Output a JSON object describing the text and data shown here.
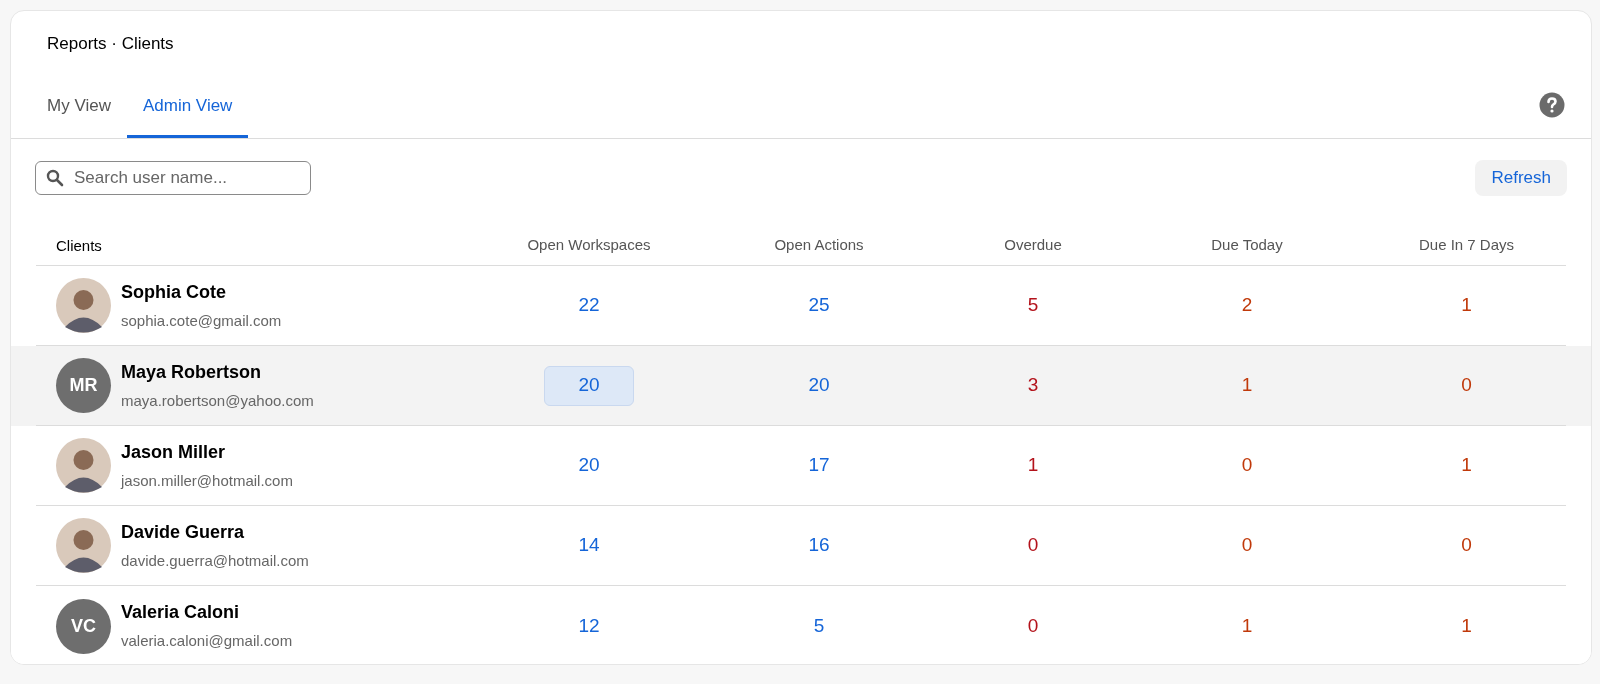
{
  "breadcrumb": "Reports · Clients",
  "tabs": [
    {
      "label": "My View",
      "selected": false
    },
    {
      "label": "Admin View",
      "selected": true
    }
  ],
  "search": {
    "placeholder": "Search user name..."
  },
  "refresh_button": "Refresh",
  "table": {
    "columns": [
      {
        "label": "Clients",
        "kind": "client"
      },
      {
        "label": "Open Workspaces",
        "kind": "count"
      },
      {
        "label": "Open Actions",
        "kind": "count"
      },
      {
        "label": "Overdue",
        "kind": "alert"
      },
      {
        "label": "Due Today",
        "kind": "warning"
      },
      {
        "label": "Due In 7 Days",
        "kind": "warning"
      }
    ],
    "rows": [
      {
        "highlighted": false,
        "cells": [
          {
            "name": "Sophia Cote",
            "email": "sophia.cote@gmail.com",
            "avatar": {
              "kind": "photo"
            },
            "focused": false
          },
          {
            "value": "22",
            "focused": false
          },
          {
            "value": "25",
            "focused": false
          },
          {
            "value": "5",
            "focused": false
          },
          {
            "value": "2",
            "focused": false
          },
          {
            "value": "1",
            "focused": false
          }
        ]
      },
      {
        "highlighted": true,
        "cells": [
          {
            "name": "Maya Robertson",
            "email": "maya.robertson@yahoo.com",
            "avatar": {
              "kind": "initials",
              "initials": "MR"
            },
            "focused": false
          },
          {
            "value": "20",
            "focused": true
          },
          {
            "value": "20",
            "focused": false
          },
          {
            "value": "3",
            "focused": false
          },
          {
            "value": "1",
            "focused": false
          },
          {
            "value": "0",
            "focused": false
          }
        ]
      },
      {
        "highlighted": false,
        "cells": [
          {
            "name": "Jason Miller",
            "email": "jason.miller@hotmail.com",
            "avatar": {
              "kind": "photo"
            },
            "focused": false
          },
          {
            "value": "20",
            "focused": false
          },
          {
            "value": "17",
            "focused": false
          },
          {
            "value": "1",
            "focused": false
          },
          {
            "value": "0",
            "focused": false
          },
          {
            "value": "1",
            "focused": false
          }
        ]
      },
      {
        "highlighted": false,
        "cells": [
          {
            "name": "Davide Guerra",
            "email": "davide.guerra@hotmail.com",
            "avatar": {
              "kind": "photo"
            },
            "focused": false
          },
          {
            "value": "14",
            "focused": false
          },
          {
            "value": "16",
            "focused": false
          },
          {
            "value": "0",
            "focused": false
          },
          {
            "value": "0",
            "focused": false
          },
          {
            "value": "0",
            "focused": false
          }
        ]
      },
      {
        "highlighted": false,
        "cells": [
          {
            "name": "Valeria Caloni",
            "email": "valeria.caloni@gmail.com",
            "avatar": {
              "kind": "initials",
              "initials": "VC"
            },
            "focused": false
          },
          {
            "value": "12",
            "focused": false
          },
          {
            "value": "5",
            "focused": false
          },
          {
            "value": "0",
            "focused": false
          },
          {
            "value": "1",
            "focused": false
          },
          {
            "value": "1",
            "focused": false
          }
        ]
      }
    ]
  }
}
